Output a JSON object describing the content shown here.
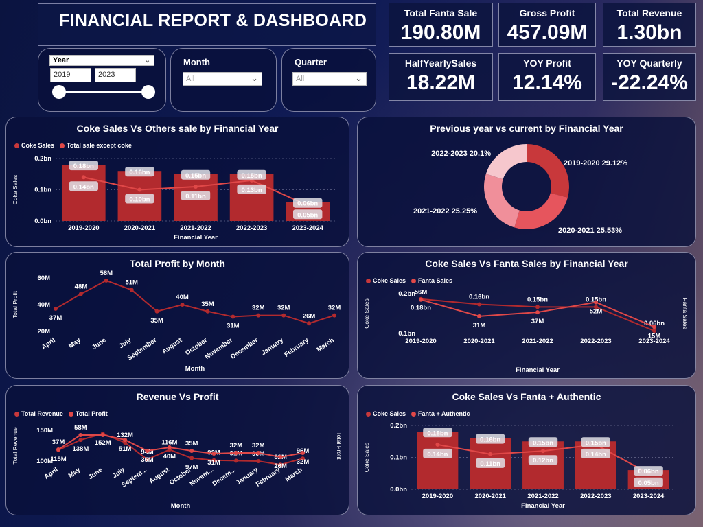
{
  "header": {
    "title": "FINANCIAL REPORT & DASHBOARD"
  },
  "kpis": [
    {
      "label": "Total Fanta Sale",
      "value": "190.80M"
    },
    {
      "label": "Gross Profit",
      "value": "457.09M"
    },
    {
      "label": "Total Revenue",
      "value": "1.30bn"
    },
    {
      "label": "HalfYearlySales",
      "value": "18.22M"
    },
    {
      "label": "YOY Profit",
      "value": "12.14%"
    },
    {
      "label": "YOY Quarterly",
      "value": "-22.24%"
    }
  ],
  "slicers": {
    "year": {
      "label": "Year",
      "from": "2019",
      "to": "2023"
    },
    "month": {
      "label": "Month",
      "value": "All"
    },
    "quarter": {
      "label": "Quarter",
      "value": "All"
    }
  },
  "colors": {
    "bar": "#b22a2e",
    "line": "#e04848",
    "pie": [
      "#c8383b",
      "#e6555d",
      "#f08f9a",
      "#f6c7cd"
    ]
  },
  "chart_data": [
    {
      "id": "coke_vs_others",
      "type": "bar",
      "title": "Coke Sales Vs Others sale by Financial Year",
      "xlabel": "Financial Year",
      "ylabel": "Coke Sales",
      "yticks": [
        "0.0bn",
        "0.1bn",
        "0.2bn"
      ],
      "ylim": [
        0,
        0.2
      ],
      "categories": [
        "2019-2020",
        "2020-2021",
        "2021-2022",
        "2022-2023",
        "2023-2024"
      ],
      "series": [
        {
          "name": "Coke Sales",
          "kind": "bar",
          "values": [
            0.18,
            0.16,
            0.15,
            0.15,
            0.06
          ],
          "labels": [
            "0.18bn",
            "0.16bn",
            "0.15bn",
            "0.15bn",
            "0.06bn"
          ]
        },
        {
          "name": "Total sale except coke",
          "kind": "line",
          "values": [
            0.14,
            0.1,
            0.11,
            0.13,
            0.05
          ],
          "labels": [
            "0.14bn",
            "0.10bn",
            "0.11bn",
            "0.13bn",
            "0.05bn"
          ]
        }
      ]
    },
    {
      "id": "prev_vs_current",
      "type": "pie",
      "title": "Previous year vs current by Financial Year",
      "slices": [
        {
          "label": "2019-2020 29.12%",
          "value": 29.12
        },
        {
          "label": "2020-2021 25.53%",
          "value": 25.53
        },
        {
          "label": "2021-2022 25.25%",
          "value": 25.25
        },
        {
          "label": "2022-2023 20.1%",
          "value": 20.1
        }
      ]
    },
    {
      "id": "profit_by_month",
      "type": "line",
      "title": "Total Profit by Month",
      "xlabel": "Month",
      "ylabel": "Total Profit",
      "yticks": [
        "20M",
        "40M",
        "60M"
      ],
      "ylim": [
        20,
        60
      ],
      "categories": [
        "April",
        "May",
        "June",
        "July",
        "September",
        "August",
        "October",
        "November",
        "December",
        "January",
        "February",
        "March"
      ],
      "series": [
        {
          "name": "Total Profit",
          "values": [
            37,
            48,
            58,
            51,
            35,
            40,
            35,
            31,
            32,
            32,
            26,
            32
          ],
          "labels": [
            "37M",
            "48M",
            "58M",
            "51M",
            "35M",
            "40M",
            "35M",
            "31M",
            "32M",
            "32M",
            "26M",
            "32M"
          ]
        }
      ]
    },
    {
      "id": "coke_vs_fanta",
      "type": "line",
      "title": "Coke Sales Vs Fanta Sales by Financial Year",
      "xlabel": "Financial Year",
      "ylabel": "Coke Sales",
      "y2label": "Fanta Sales",
      "yticks": [
        "0.1bn",
        "0.2bn"
      ],
      "categories": [
        "2019-2020",
        "2020-2021",
        "2021-2022",
        "2022-2023",
        "2023-2024"
      ],
      "series": [
        {
          "name": "Coke Sales",
          "values": [
            0.18,
            0.16,
            0.15,
            0.15,
            0.06
          ],
          "labels": [
            "0.18bn",
            "0.16bn",
            "0.15bn",
            "0.15bn",
            "0.06bn"
          ]
        },
        {
          "name": "Fanta Sales",
          "values": [
            56,
            31,
            37,
            52,
            15
          ],
          "labels": [
            "56M",
            "31M",
            "37M",
            "52M",
            "15M"
          ]
        }
      ]
    },
    {
      "id": "revenue_vs_profit",
      "type": "line",
      "title": "Revenue Vs Profit",
      "xlabel": "Month",
      "ylabel": "Total Revenue",
      "y2label": "Total Profit",
      "yticks": [
        "100M",
        "150M"
      ],
      "categories": [
        "April",
        "May",
        "June",
        "July",
        "Septem...",
        "August",
        "October",
        "Novem...",
        "Decem...",
        "January",
        "February",
        "March"
      ],
      "series": [
        {
          "name": "Total Revenue",
          "values": [
            115,
            138,
            152,
            132,
            94,
            116,
            97,
            92,
            91,
            90,
            82,
            96
          ],
          "labels": [
            "115M",
            "138M",
            "152M",
            "132M",
            "94M",
            "116M",
            "97M",
            "92M",
            "91M",
            "90M",
            "82M",
            "96M"
          ]
        },
        {
          "name": "Total Profit",
          "values": [
            37,
            58,
            58,
            51,
            35,
            40,
            35,
            31,
            32,
            32,
            26,
            32
          ],
          "labels": [
            "37M",
            "58M",
            "",
            "51M",
            "35M",
            "40M",
            "35M",
            "31M",
            "32M",
            "32M",
            "26M",
            "32M"
          ]
        }
      ]
    },
    {
      "id": "coke_vs_fanta_authentic",
      "type": "bar",
      "title": "Coke Sales Vs Fanta + Authentic",
      "xlabel": "Financial Year",
      "ylabel": "Coke Sales",
      "yticks": [
        "0.0bn",
        "0.1bn",
        "0.2bn"
      ],
      "ylim": [
        0,
        0.2
      ],
      "categories": [
        "2019-2020",
        "2020-2021",
        "2021-2022",
        "2022-2023",
        "2023-2024"
      ],
      "series": [
        {
          "name": "Coke Sales",
          "kind": "bar",
          "values": [
            0.18,
            0.16,
            0.15,
            0.15,
            0.06
          ],
          "labels": [
            "0.18bn",
            "0.16bn",
            "0.15bn",
            "0.15bn",
            "0.06bn"
          ]
        },
        {
          "name": "Fanta + Authentic",
          "kind": "line",
          "values": [
            0.14,
            0.11,
            0.12,
            0.14,
            0.05
          ],
          "labels": [
            "0.14bn",
            "0.11bn",
            "0.12bn",
            "0.14bn",
            "0.05bn"
          ]
        }
      ]
    }
  ]
}
